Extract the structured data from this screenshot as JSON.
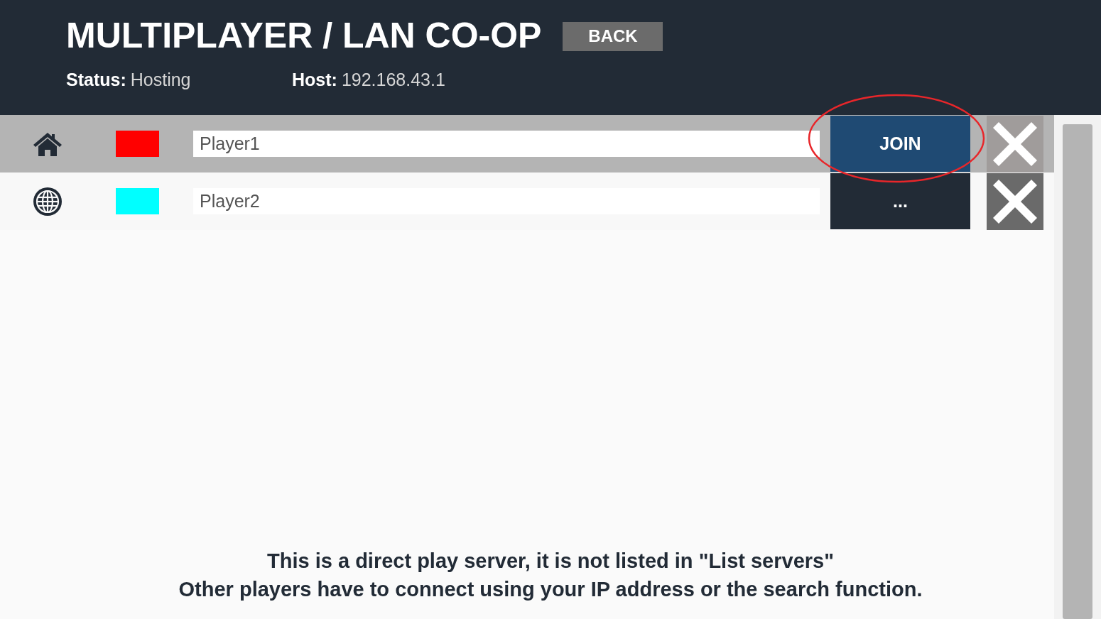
{
  "header": {
    "title": "MULTIPLAYER / LAN CO-OP",
    "back_button": "BACK",
    "status": {
      "label": "Status:",
      "value": "Hosting"
    },
    "host": {
      "label": "Host:",
      "value": "192.168.43.1"
    }
  },
  "players": [
    {
      "kind": "home",
      "color": "#ff0000",
      "name": "Player1",
      "action": "JOIN",
      "selected": true
    },
    {
      "kind": "globe",
      "color": "#00ffff",
      "name": "Player2",
      "action": "...",
      "selected": false
    }
  ],
  "notice": [
    "This is a direct play server, it is not listed in \"List servers\"",
    "Other players have to connect using your IP address or the search function."
  ]
}
